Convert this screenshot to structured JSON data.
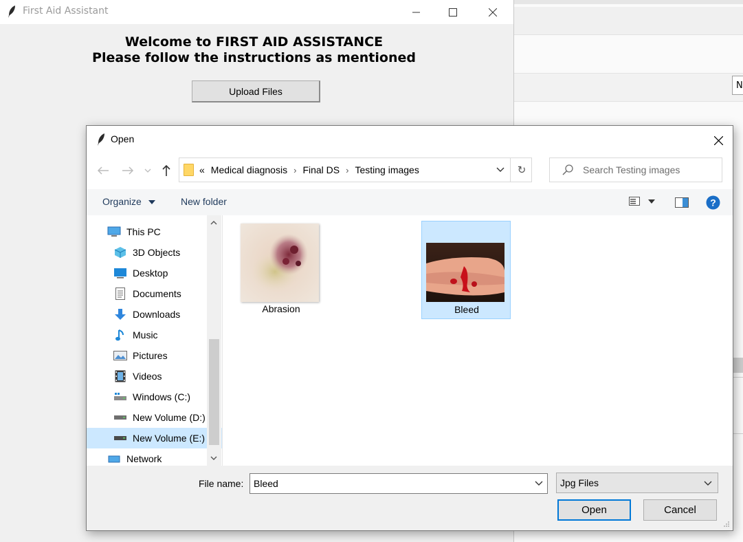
{
  "main_window": {
    "title": "First Aid Assistant",
    "heading_line1": "Welcome to FIRST AID ASSISTANCE",
    "heading_line2": "Please follow the instructions as mentioned",
    "upload_button": "Upload Files"
  },
  "background_window": {
    "field_fragment": "N"
  },
  "dialog": {
    "title": "Open",
    "breadcrumb": [
      "Medical diagnosis",
      "Final DS",
      "Testing images"
    ],
    "breadcrumb_overflow": "«",
    "search_placeholder": "Search Testing images",
    "toolbar": {
      "organize": "Organize",
      "new_folder": "New folder"
    },
    "sidebar": [
      {
        "label": "This PC",
        "icon": "computer-icon"
      },
      {
        "label": "3D Objects",
        "icon": "cube-icon"
      },
      {
        "label": "Desktop",
        "icon": "desktop-icon"
      },
      {
        "label": "Documents",
        "icon": "document-icon"
      },
      {
        "label": "Downloads",
        "icon": "download-arrow-icon"
      },
      {
        "label": "Music",
        "icon": "music-note-icon"
      },
      {
        "label": "Pictures",
        "icon": "pictures-icon"
      },
      {
        "label": "Videos",
        "icon": "film-icon"
      },
      {
        "label": "Windows (C:)",
        "icon": "windows-drive-icon"
      },
      {
        "label": "New Volume (D:)",
        "icon": "drive-icon"
      },
      {
        "label": "New Volume (E:)",
        "icon": "drive-icon",
        "selected": true
      },
      {
        "label": "Network",
        "icon": "network-icon"
      }
    ],
    "files": [
      {
        "name": "Abrasion",
        "selected": false
      },
      {
        "name": "Bleed",
        "selected": true
      }
    ],
    "file_name_label": "File name:",
    "file_name_value": "Bleed",
    "file_type": "Jpg Files",
    "open_button": "Open",
    "cancel_button": "Cancel"
  },
  "colors": {
    "selection": "#cce8ff",
    "accent": "#0078d7"
  }
}
